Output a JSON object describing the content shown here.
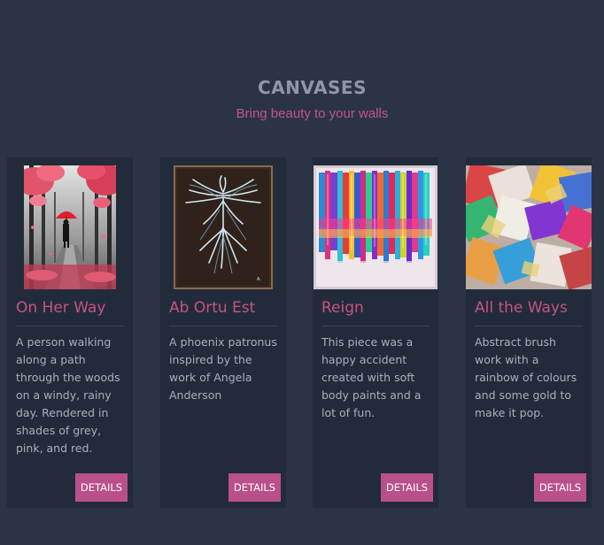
{
  "section": {
    "title": "CANVASES",
    "subtitle": "Bring beauty to your walls"
  },
  "cards": [
    {
      "title": "On Her Way",
      "description": "A person walking along a path through the woods on a windy, rainy day. Rendered in shades of grey, pink, and red.",
      "button": "DETAILS"
    },
    {
      "title": "Ab Ortu Est",
      "description": "A phoenix patronus inspired by the work of Angela Anderson",
      "button": "DETAILS"
    },
    {
      "title": "Reign",
      "description": "This piece was a happy accident created with soft body paints and a lot of fun.",
      "button": "DETAILS"
    },
    {
      "title": "All the Ways",
      "description": "Abstract brush work with a rainbow of colours and some gold to make it pop.",
      "button": "DETAILS"
    }
  ],
  "colors": {
    "background": "#2a3445",
    "card": "#222b3a",
    "accent": "#c5538a",
    "button": "#b9508a",
    "title": "#8d97a6",
    "text": "#a7b0bd"
  }
}
